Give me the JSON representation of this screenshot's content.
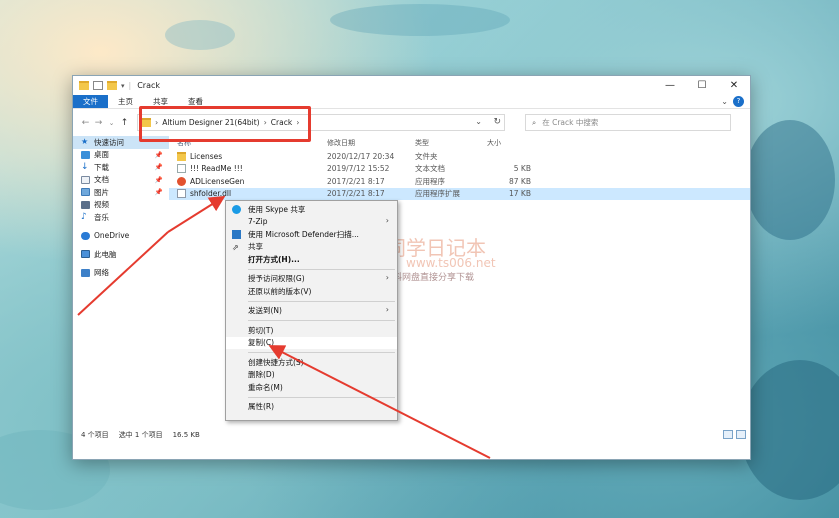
{
  "window": {
    "title": "Crack",
    "controls": [
      "—",
      "☐",
      "✕"
    ]
  },
  "ribbon": {
    "tabs": [
      "文件",
      "主页",
      "共享",
      "查看"
    ]
  },
  "address": {
    "crumbs": [
      "Altium Designer 21(64bit)",
      "Crack"
    ],
    "search_placeholder": "在 Crack 中搜索"
  },
  "navpane": {
    "items": [
      {
        "label": "快速访问",
        "icon": "star-icon"
      },
      {
        "label": "桌面",
        "icon": "desktop-icon"
      },
      {
        "label": "下载",
        "icon": "download-icon"
      },
      {
        "label": "文档",
        "icon": "documents-icon"
      },
      {
        "label": "图片",
        "icon": "pictures-icon"
      },
      {
        "label": "视频",
        "icon": "videos-icon"
      },
      {
        "label": "音乐",
        "icon": "music-icon"
      },
      {
        "label": "OneDrive",
        "icon": "onedrive-icon"
      },
      {
        "label": "此电脑",
        "icon": "pc-icon"
      },
      {
        "label": "网络",
        "icon": "network-icon"
      }
    ]
  },
  "columns": {
    "name": "名称",
    "date": "修改日期",
    "type": "类型",
    "size": "大小"
  },
  "files": [
    {
      "name": "Licenses",
      "date": "2020/12/17 20:34",
      "type": "文件夹",
      "size": "",
      "icon": "folder-icon"
    },
    {
      "name": "!!! ReadMe !!!",
      "date": "2019/7/12 15:52",
      "type": "文本文档",
      "size": "5 KB",
      "icon": "text-file-icon"
    },
    {
      "name": "ADLicenseGen",
      "date": "2017/2/21 8:17",
      "type": "应用程序",
      "size": "87 KB",
      "icon": "exe-icon"
    },
    {
      "name": "shfolder.dll",
      "date": "2017/2/21 8:17",
      "type": "应用程序扩展",
      "size": "17 KB",
      "icon": "dll-icon"
    }
  ],
  "status": {
    "count": "4 个项目",
    "selected": "选中 1 个项目",
    "size": "16.5 KB"
  },
  "context_menu": {
    "items": [
      {
        "label": "使用 Skype 共享",
        "icon": "skype-icon"
      },
      {
        "label": "7-Zip",
        "submenu": true
      },
      {
        "label": "使用 Microsoft Defender扫描...",
        "icon": "defender-icon"
      },
      {
        "label": "共享",
        "icon": "share-icon"
      },
      {
        "label": "打开方式(H)..."
      },
      {
        "label": "授予访问权限(G)",
        "submenu": true
      },
      {
        "label": "还原以前的版本(V)"
      },
      {
        "label": "发送到(N)",
        "submenu": true
      },
      {
        "label": "剪切(T)"
      },
      {
        "label": "复制(C)"
      },
      {
        "label": "创建快捷方式(S)"
      },
      {
        "label": "删除(D)"
      },
      {
        "label": "重命名(M)"
      },
      {
        "label": "属性(R)"
      }
    ]
  },
  "watermark": {
    "title": "丁同学日记本",
    "url": "www.ts006.net",
    "tagline": "软件、资源、资料网盘直接分享下载"
  },
  "colors": {
    "accent": "#1a6fc9",
    "annotation": "#e53b2f",
    "selection": "#cce8ff"
  }
}
